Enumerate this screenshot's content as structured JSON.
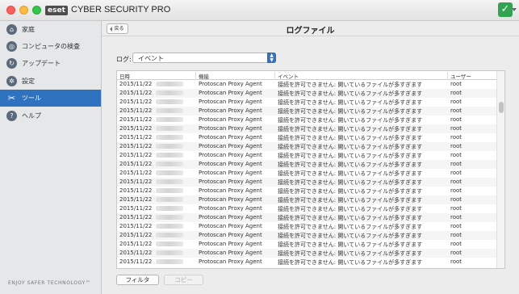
{
  "app": {
    "logo_text": "eset",
    "title": "CYBER SECURITY PRO",
    "status_icon": "checkmark-icon",
    "status_glyph": "✓"
  },
  "sidebar": {
    "items": [
      {
        "label": "家庭",
        "icon": "home-icon",
        "glyph": "⌂"
      },
      {
        "label": "コンピュータの検査",
        "icon": "search-icon",
        "glyph": "◎"
      },
      {
        "label": "アップデート",
        "icon": "update-icon",
        "glyph": "↻"
      },
      {
        "label": "設定",
        "icon": "gear-icon",
        "glyph": "✲"
      },
      {
        "label": "ツール",
        "icon": "tools-icon",
        "glyph": "✂"
      },
      {
        "label": "ヘルプ",
        "icon": "help-icon",
        "glyph": "?"
      }
    ],
    "active_index": 4,
    "footer": "ENJOY SAFER TECHNOLOGY™"
  },
  "header": {
    "back_label": "戻る",
    "title": "ログファイル"
  },
  "log_selector": {
    "label": "ログ:",
    "value": "イベント"
  },
  "table": {
    "columns": [
      "日時",
      "機能",
      "イベント",
      "ユーザー"
    ],
    "rows": [
      {
        "date": "2015/11/22",
        "feature": "Protoscan Proxy Agent",
        "event": "接続を許可できません: 開いているファイルが多すぎます",
        "user": "root"
      },
      {
        "date": "2015/11/22",
        "feature": "Protoscan Proxy Agent",
        "event": "接続を許可できません: 開いているファイルが多すぎます",
        "user": "root"
      },
      {
        "date": "2015/11/22",
        "feature": "Protoscan Proxy Agent",
        "event": "接続を許可できません: 開いているファイルが多すぎます",
        "user": "root"
      },
      {
        "date": "2015/11/22",
        "feature": "Protoscan Proxy Agent",
        "event": "接続を許可できません: 開いているファイルが多すぎます",
        "user": "root"
      },
      {
        "date": "2015/11/22",
        "feature": "Protoscan Proxy Agent",
        "event": "接続を許可できません: 開いているファイルが多すぎます",
        "user": "root"
      },
      {
        "date": "2015/11/22",
        "feature": "Protoscan Proxy Agent",
        "event": "接続を許可できません: 開いているファイルが多すぎます",
        "user": "root"
      },
      {
        "date": "2015/11/22",
        "feature": "Protoscan Proxy Agent",
        "event": "接続を許可できません: 開いているファイルが多すぎます",
        "user": "root"
      },
      {
        "date": "2015/11/22",
        "feature": "Protoscan Proxy Agent",
        "event": "接続を許可できません: 開いているファイルが多すぎます",
        "user": "root"
      },
      {
        "date": "2015/11/22",
        "feature": "Protoscan Proxy Agent",
        "event": "接続を許可できません: 開いているファイルが多すぎます",
        "user": "root"
      },
      {
        "date": "2015/11/22",
        "feature": "Protoscan Proxy Agent",
        "event": "接続を許可できません: 開いているファイルが多すぎます",
        "user": "root"
      },
      {
        "date": "2015/11/22",
        "feature": "Protoscan Proxy Agent",
        "event": "接続を許可できません: 開いているファイルが多すぎます",
        "user": "root"
      },
      {
        "date": "2015/11/22",
        "feature": "Protoscan Proxy Agent",
        "event": "接続を許可できません: 開いているファイルが多すぎます",
        "user": "root"
      },
      {
        "date": "2015/11/22",
        "feature": "Protoscan Proxy Agent",
        "event": "接続を許可できません: 開いているファイルが多すぎます",
        "user": "root"
      },
      {
        "date": "2015/11/22",
        "feature": "Protoscan Proxy Agent",
        "event": "接続を許可できません: 開いているファイルが多すぎます",
        "user": "root"
      },
      {
        "date": "2015/11/22",
        "feature": "Protoscan Proxy Agent",
        "event": "接続を許可できません: 開いているファイルが多すぎます",
        "user": "root"
      },
      {
        "date": "2015/11/22",
        "feature": "Protoscan Proxy Agent",
        "event": "接続を許可できません: 開いているファイルが多すぎます",
        "user": "root"
      },
      {
        "date": "2015/11/22",
        "feature": "Protoscan Proxy Agent",
        "event": "接続を許可できません: 開いているファイルが多すぎます",
        "user": "root"
      },
      {
        "date": "2015/11/22",
        "feature": "Protoscan Proxy Agent",
        "event": "接続を許可できません: 開いているファイルが多すぎます",
        "user": "root"
      },
      {
        "date": "2015/11/22",
        "feature": "Protoscan Proxy Agent",
        "event": "接続を許可できません: 開いているファイルが多すぎます",
        "user": "root"
      },
      {
        "date": "2015/11/22",
        "feature": "Protoscan Proxy Agent",
        "event": "接続を許可できません: 開いているファイルが多すぎます",
        "user": "root"
      },
      {
        "date": "2015/11/22",
        "feature": "Protoscan Proxy Agent",
        "event": "接続を許可できません: 開いているファイルが多すぎます",
        "user": "root"
      }
    ]
  },
  "actions": {
    "filter_label": "フィルタ",
    "copy_label": "コピー"
  },
  "colors": {
    "accent": "#2f72c0",
    "status_ok": "#32a350"
  }
}
